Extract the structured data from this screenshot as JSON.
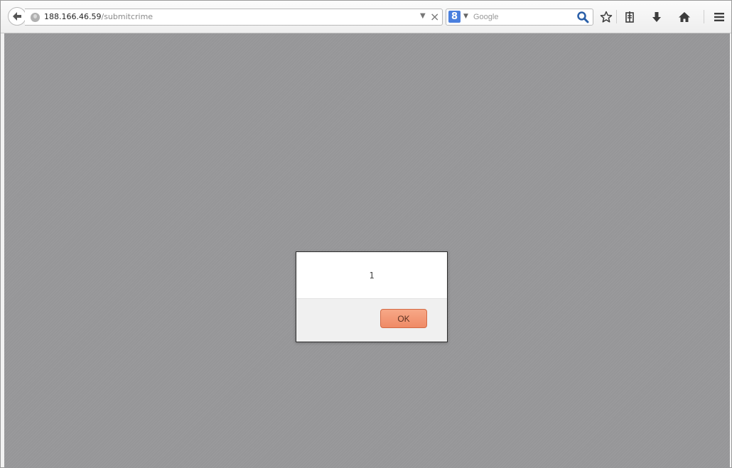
{
  "address_bar": {
    "host": "188.166.46.59",
    "path": "/submitcrime"
  },
  "search_bar": {
    "engine_letter": "8",
    "placeholder": "Google"
  },
  "toolbar_icons": [
    "back-arrow-icon",
    "globe-icon",
    "dropdown-icon",
    "stop-icon",
    "search-engine-icon",
    "search-icon",
    "bookmark-star-icon",
    "reading-list-icon",
    "downloads-icon",
    "home-icon",
    "menu-icon"
  ],
  "alert": {
    "message": "1",
    "ok_label": "OK"
  },
  "colors": {
    "overlay": "#969698",
    "ok_button": "#f19470",
    "search_icon": "#2a5fa8"
  }
}
